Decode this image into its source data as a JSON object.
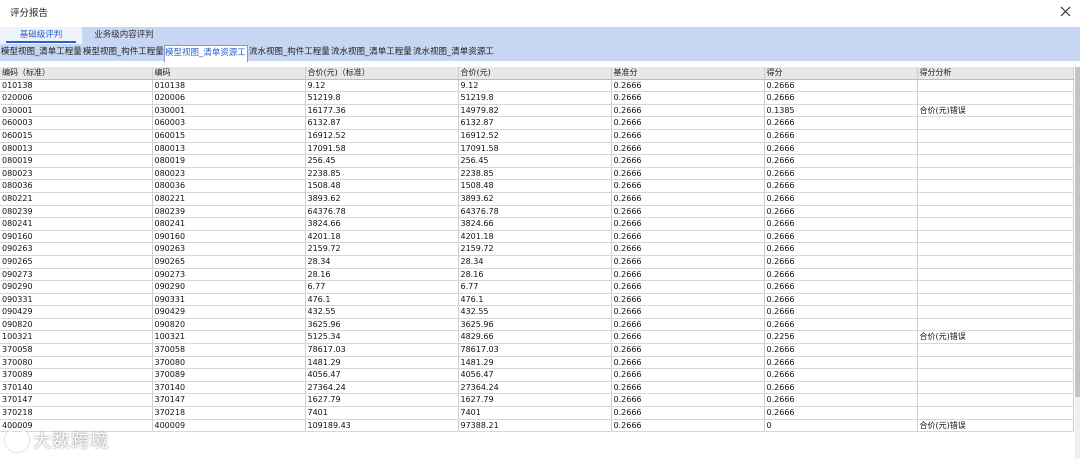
{
  "window": {
    "title": "评分报告",
    "close_label": "×"
  },
  "top_tabs": [
    {
      "label": "基础级评判",
      "active": true
    },
    {
      "label": "业务级内容评判",
      "active": false
    }
  ],
  "sub_tabs": [
    {
      "label": "模型视图_清单工程量",
      "active": false
    },
    {
      "label": "模型视图_构件工程量",
      "active": false
    },
    {
      "label": "模型视图_清单资源工",
      "active": true
    },
    {
      "label": "流水视图_构件工程量",
      "active": false
    },
    {
      "label": "流水视图_清单工程量",
      "active": false
    },
    {
      "label": "流水视图_清单资源工",
      "active": false
    }
  ],
  "table": {
    "columns": [
      "编码（标准）",
      "编码",
      "合价(元)（标准）",
      "合价(元)",
      "基准分",
      "得分",
      "得分分析"
    ],
    "rows": [
      [
        "010138",
        "010138",
        "9.12",
        "9.12",
        "0.2666",
        "0.2666",
        ""
      ],
      [
        "020006",
        "020006",
        "51219.8",
        "51219.8",
        "0.2666",
        "0.2666",
        ""
      ],
      [
        "030001",
        "030001",
        "16177.36",
        "14979.82",
        "0.2666",
        "0.1385",
        "合价(元)错误"
      ],
      [
        "060003",
        "060003",
        "6132.87",
        "6132.87",
        "0.2666",
        "0.2666",
        ""
      ],
      [
        "060015",
        "060015",
        "16912.52",
        "16912.52",
        "0.2666",
        "0.2666",
        ""
      ],
      [
        "080013",
        "080013",
        "17091.58",
        "17091.58",
        "0.2666",
        "0.2666",
        ""
      ],
      [
        "080019",
        "080019",
        "256.45",
        "256.45",
        "0.2666",
        "0.2666",
        ""
      ],
      [
        "080023",
        "080023",
        "2238.85",
        "2238.85",
        "0.2666",
        "0.2666",
        ""
      ],
      [
        "080036",
        "080036",
        "1508.48",
        "1508.48",
        "0.2666",
        "0.2666",
        ""
      ],
      [
        "080221",
        "080221",
        "3893.62",
        "3893.62",
        "0.2666",
        "0.2666",
        ""
      ],
      [
        "080239",
        "080239",
        "64376.78",
        "64376.78",
        "0.2666",
        "0.2666",
        ""
      ],
      [
        "080241",
        "080241",
        "3824.66",
        "3824.66",
        "0.2666",
        "0.2666",
        ""
      ],
      [
        "090160",
        "090160",
        "4201.18",
        "4201.18",
        "0.2666",
        "0.2666",
        ""
      ],
      [
        "090263",
        "090263",
        "2159.72",
        "2159.72",
        "0.2666",
        "0.2666",
        ""
      ],
      [
        "090265",
        "090265",
        "28.34",
        "28.34",
        "0.2666",
        "0.2666",
        ""
      ],
      [
        "090273",
        "090273",
        "28.16",
        "28.16",
        "0.2666",
        "0.2666",
        ""
      ],
      [
        "090290",
        "090290",
        "6.77",
        "6.77",
        "0.2666",
        "0.2666",
        ""
      ],
      [
        "090331",
        "090331",
        "476.1",
        "476.1",
        "0.2666",
        "0.2666",
        ""
      ],
      [
        "090429",
        "090429",
        "432.55",
        "432.55",
        "0.2666",
        "0.2666",
        ""
      ],
      [
        "090820",
        "090820",
        "3625.96",
        "3625.96",
        "0.2666",
        "0.2666",
        ""
      ],
      [
        "100321",
        "100321",
        "5125.34",
        "4829.66",
        "0.2666",
        "0.2256",
        "合价(元)错误"
      ],
      [
        "370058",
        "370058",
        "78617.03",
        "78617.03",
        "0.2666",
        "0.2666",
        ""
      ],
      [
        "370080",
        "370080",
        "1481.29",
        "1481.29",
        "0.2666",
        "0.2666",
        ""
      ],
      [
        "370089",
        "370089",
        "4056.47",
        "4056.47",
        "0.2666",
        "0.2666",
        ""
      ],
      [
        "370140",
        "370140",
        "27364.24",
        "27364.24",
        "0.2666",
        "0.2666",
        ""
      ],
      [
        "370147",
        "370147",
        "1627.79",
        "1627.79",
        "0.2666",
        "0.2666",
        ""
      ],
      [
        "370218",
        "370218",
        "7401",
        "7401",
        "0.2666",
        "0.2666",
        ""
      ],
      [
        "400009",
        "400009",
        "109189.43",
        "97388.21",
        "0.2666",
        "0",
        "合价(元)错误"
      ]
    ]
  },
  "watermark": {
    "text": "大数跨境"
  },
  "colors": {
    "tab_bar": "#c7d6f3",
    "accent": "#2b60c8",
    "header_bg": "#e8e8e8"
  }
}
